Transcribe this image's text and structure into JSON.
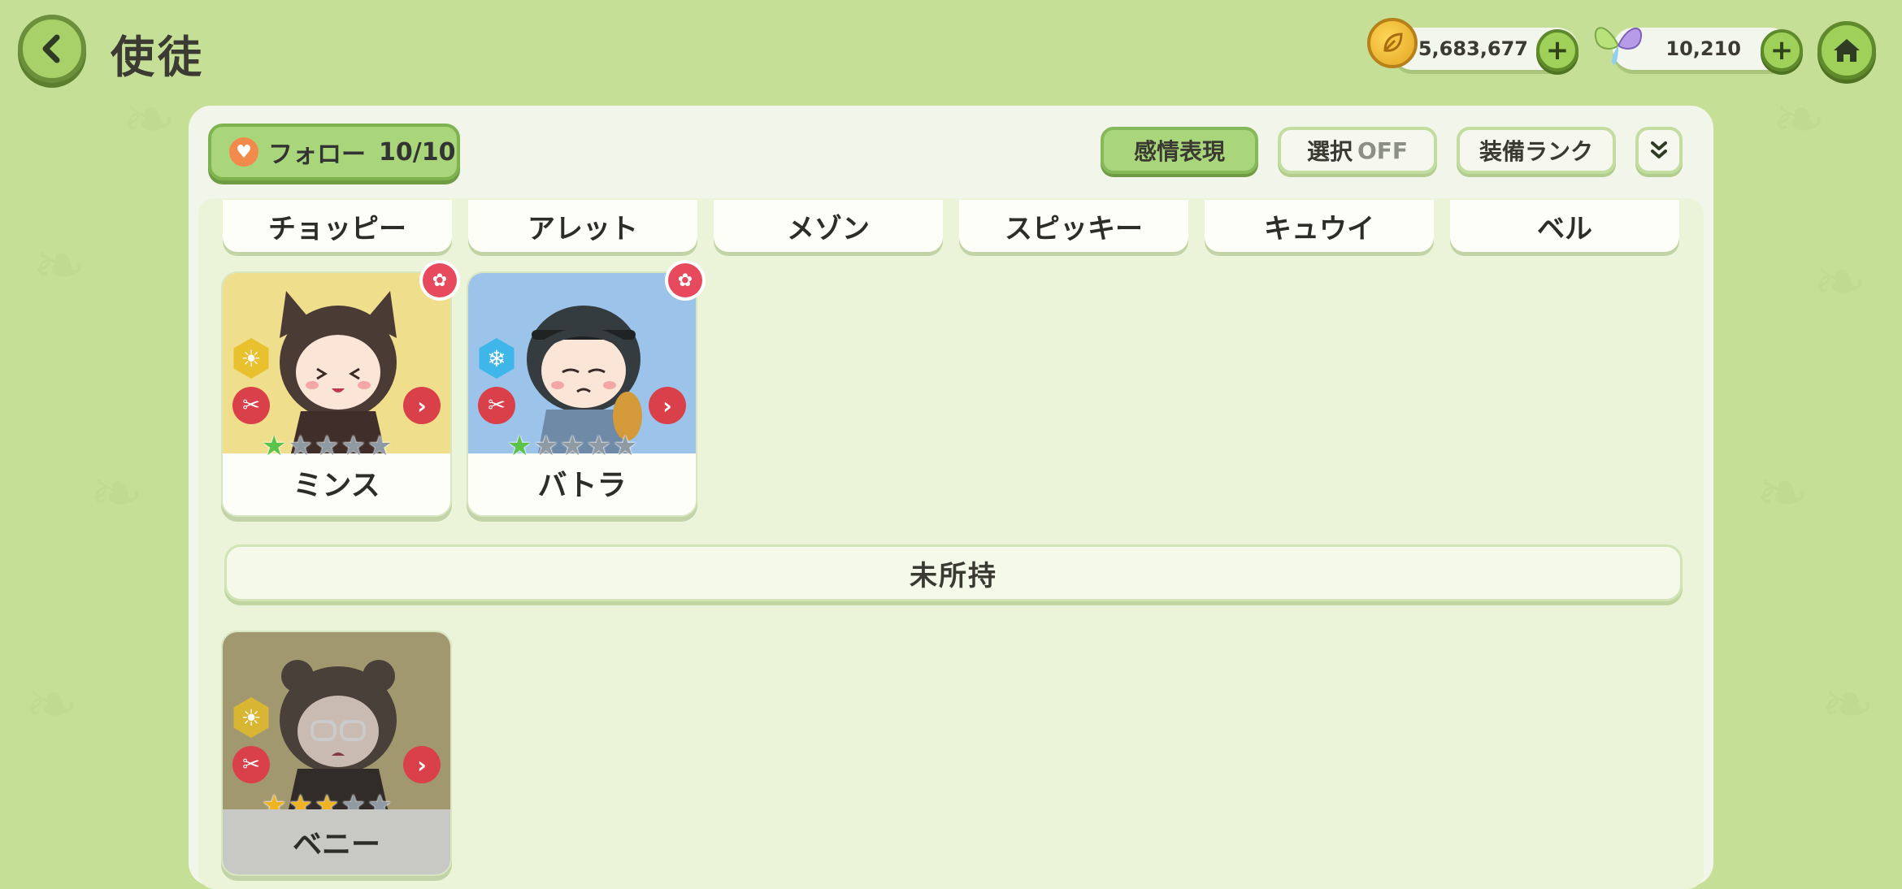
{
  "header": {
    "title": "使徒",
    "coins": "5,683,677",
    "gems": "10,210"
  },
  "toolbar": {
    "follow_label": "フォロー",
    "follow_count": "10/10",
    "emotion_label": "感情表現",
    "select_label": "選択",
    "select_state": "OFF",
    "equip_rank_label": "装備ランク"
  },
  "name_tabs": [
    "チョッピー",
    "アレット",
    "メゾン",
    "スピッキー",
    "キュウイ",
    "ベル"
  ],
  "owned": [
    {
      "name": "ミンス",
      "element": "sun",
      "stars": 1,
      "background": "#efdf8c"
    },
    {
      "name": "バトラ",
      "element": "snowflake",
      "stars": 1,
      "background": "#9cc3ea"
    }
  ],
  "section": {
    "unowned_label": "未所持"
  },
  "unowned": [
    {
      "name": "ベニー",
      "element": "sun",
      "stars": 3,
      "background": "#c5b46a"
    }
  ],
  "colors": {
    "background": "#c6df96",
    "accent_green": "#a9d67a",
    "badge_red": "#d9404a"
  }
}
